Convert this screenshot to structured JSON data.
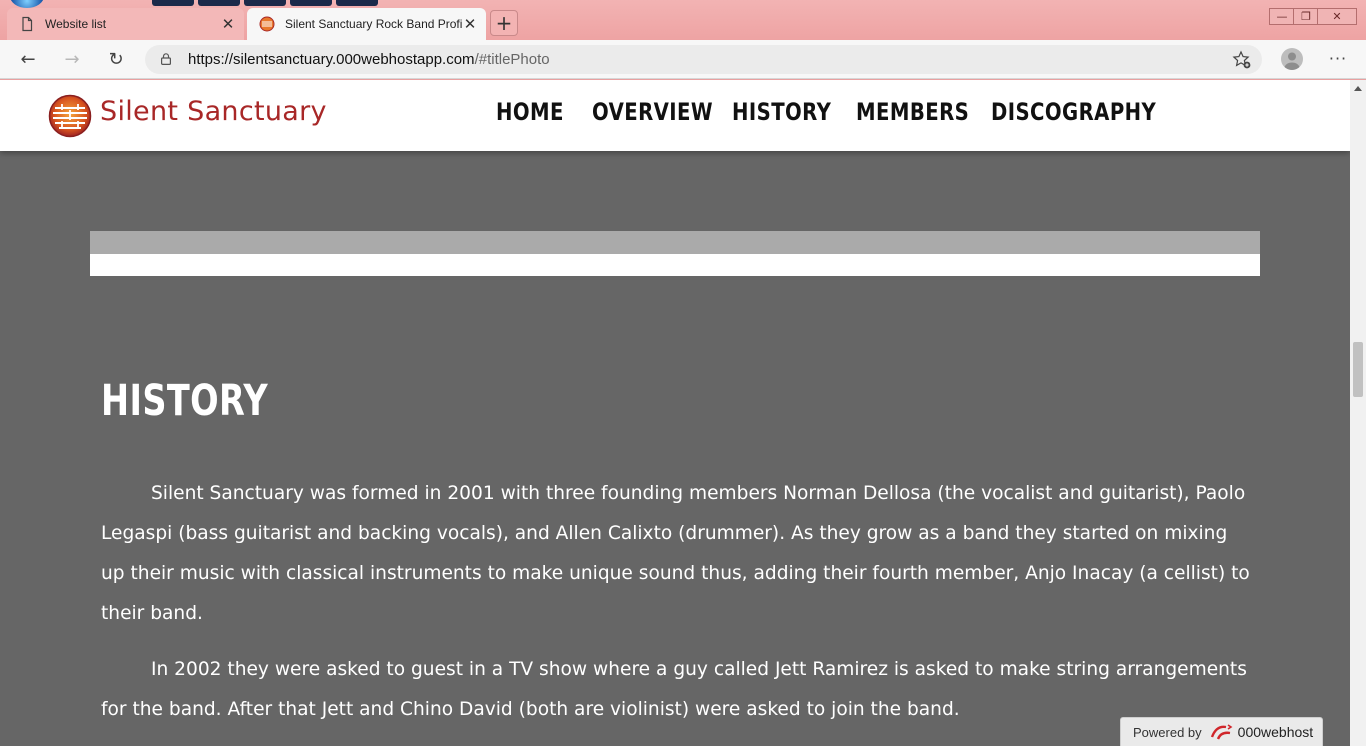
{
  "browser": {
    "tabs": [
      {
        "label": "Website list",
        "active": false
      },
      {
        "label": "Silent Sanctuary Rock Band Profi",
        "active": true
      }
    ],
    "new_tab_label": "+",
    "window_controls": {
      "minimize": "—",
      "restore": "❐",
      "close": "✕"
    },
    "nav": {
      "back": "←",
      "forward": "→",
      "refresh": "↻",
      "more": "···"
    },
    "url": {
      "domain": "https://silentsanctuary.000webhostapp.com",
      "path": "/#titlePhoto"
    }
  },
  "site": {
    "brand": "Silent Sanctuary",
    "menu": [
      "HOME",
      "OVERVIEW",
      "HISTORY",
      "MEMBERS",
      "DISCOGRAPHY"
    ]
  },
  "history": {
    "title": "HISTORY",
    "paragraphs": [
      "Silent Sanctuary was formed in 2001 with three founding members Norman Dellosa (the vocalist and guitarist), Paolo Legaspi (bass guitarist and backing vocals), and Allen Calixto (drummer). As they grow as a band they started on mixing up their music with classical instruments to make unique sound thus, adding their fourth member, Anjo Inacay (a cellist) to their band.",
      "In 2002 they were asked to guest in a TV show where a guy called Jett Ramirez is asked to make string arrangements for the band. After that Jett and Chino David (both are violinist) were asked to join the band."
    ]
  },
  "hosting_badge": {
    "prefix": "Powered by",
    "brand": "000webhost"
  },
  "colors": {
    "page_bg": "#666666",
    "brand": "#a82727",
    "tab_strip": "#eea3a3"
  }
}
